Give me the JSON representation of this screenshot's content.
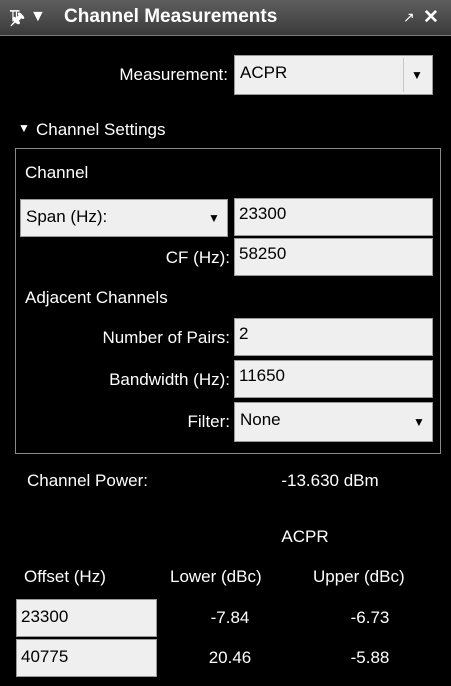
{
  "window": {
    "title": "Channel Measurements"
  },
  "measurement": {
    "label": "Measurement:",
    "value": "ACPR"
  },
  "channel_settings": {
    "header": "Channel Settings",
    "channel_label": "Channel",
    "span_select": "Span (Hz):",
    "span_value": "23300",
    "cf_label": "CF (Hz):",
    "cf_value": "58250",
    "adjacent_label": "Adjacent Channels",
    "pairs_label": "Number of Pairs:",
    "pairs_value": "2",
    "bandwidth_label": "Bandwidth (Hz):",
    "bandwidth_value": "11650",
    "filter_label": "Filter:",
    "filter_value": "None"
  },
  "results": {
    "channel_power_label": "Channel Power:",
    "channel_power_value": "-13.630 dBm",
    "acpr_label": "ACPR",
    "columns": [
      "Offset (Hz)",
      "Lower (dBc)",
      "Upper (dBc)"
    ],
    "rows": [
      {
        "offset": "23300",
        "lower": "-7.84",
        "upper": "-6.73"
      },
      {
        "offset": "40775",
        "lower": "20.46",
        "upper": "-5.88"
      }
    ]
  }
}
